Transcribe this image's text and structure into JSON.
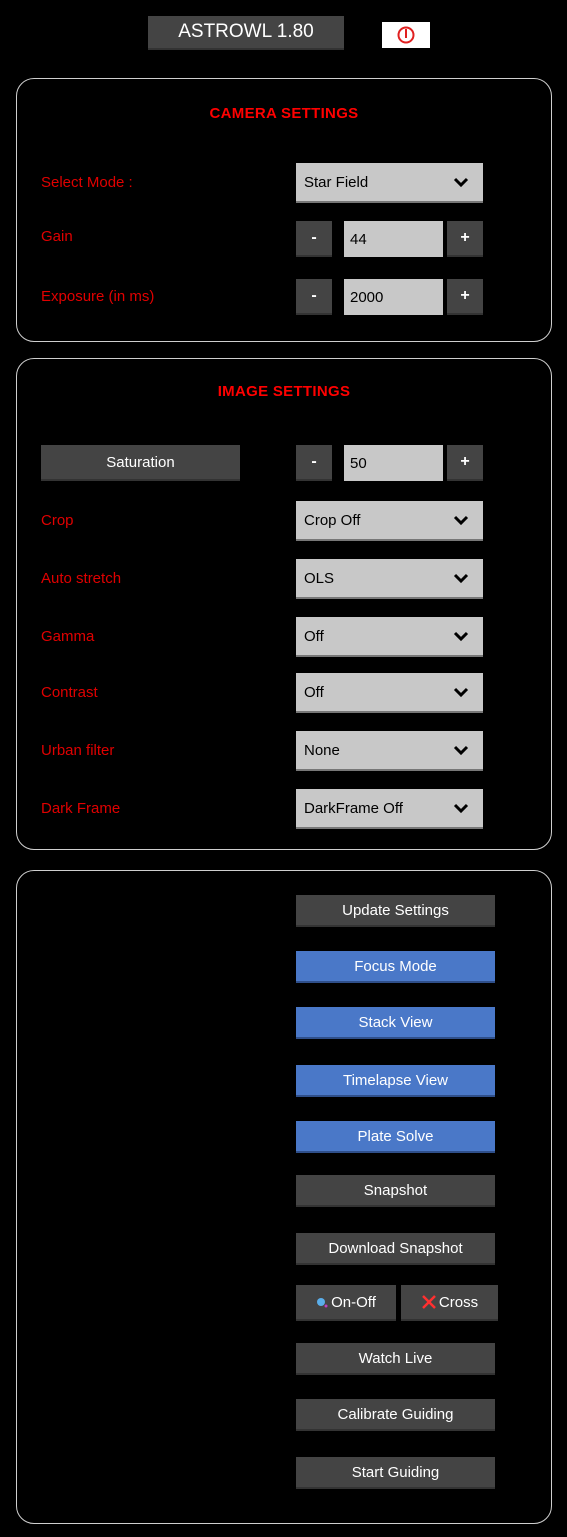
{
  "header": {
    "title": "ASTROWL 1.80",
    "power_icon": "power-icon",
    "power_color": "#e02020"
  },
  "camera": {
    "title": "CAMERA SETTINGS",
    "mode_label": "Select Mode :",
    "mode_value": "Star Field",
    "gain_label": "Gain",
    "gain_value": "44",
    "exposure_label": "Exposure (in ms)",
    "exposure_value": "2000",
    "minus": "-",
    "plus": "+"
  },
  "image": {
    "title": "IMAGE SETTINGS",
    "saturation_label": "Saturation",
    "saturation_value": "50",
    "crop_label": "Crop",
    "crop_value": "Crop Off",
    "autostretch_label": "Auto stretch",
    "autostretch_value": "OLS",
    "gamma_label": "Gamma",
    "gamma_value": "Off",
    "contrast_label": "Contrast",
    "contrast_value": "Off",
    "urban_label": "Urban filter",
    "urban_value": "None",
    "dark_label": "Dark Frame",
    "dark_value": "DarkFrame Off"
  },
  "actions": {
    "update": "Update Settings",
    "focus": "Focus Mode",
    "stack": "Stack View",
    "timelapse": "Timelapse View",
    "plate": "Plate Solve",
    "snapshot": "Snapshot",
    "download": "Download Snapshot",
    "onoff": "On-Off",
    "cross": "Cross",
    "watch": "Watch Live",
    "calibrate": "Calibrate Guiding",
    "guiding": "Start Guiding"
  },
  "colors": {
    "accent_red": "#e00000",
    "button_gray": "#444444",
    "button_blue": "#4a78c8",
    "field_gray": "#c8c8c8"
  }
}
